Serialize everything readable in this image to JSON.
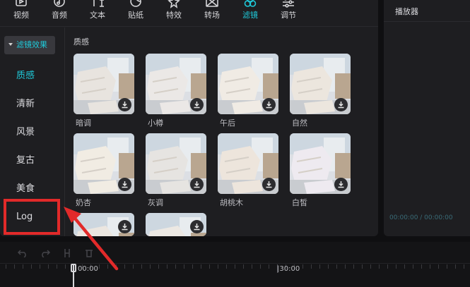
{
  "toolbar": {
    "items": [
      {
        "label": "视频",
        "icon": "video-icon"
      },
      {
        "label": "音频",
        "icon": "audio-icon"
      },
      {
        "label": "文本",
        "icon": "text-icon"
      },
      {
        "label": "贴纸",
        "icon": "sticker-icon"
      },
      {
        "label": "特效",
        "icon": "effects-icon"
      },
      {
        "label": "转场",
        "icon": "transition-icon"
      },
      {
        "label": "滤镜",
        "icon": "filter-icon",
        "active": true
      },
      {
        "label": "调节",
        "icon": "adjust-icon"
      }
    ]
  },
  "sidebar": {
    "header": "滤镜效果",
    "items": [
      {
        "label": "质感",
        "active": true
      },
      {
        "label": "清新"
      },
      {
        "label": "风景"
      },
      {
        "label": "复古"
      },
      {
        "label": "美食",
        "highlighted": true
      },
      {
        "label": "Log"
      }
    ]
  },
  "content": {
    "section_title": "质感",
    "filters": [
      {
        "name": "暗调",
        "tint": "#e8e4df"
      },
      {
        "name": "小樽",
        "tint": "#ebe8e6"
      },
      {
        "name": "午后",
        "tint": "#f0ebe4"
      },
      {
        "name": "自然",
        "tint": "#ece6de"
      },
      {
        "name": "奶杏",
        "tint": "#f1ece3"
      },
      {
        "name": "灰调",
        "tint": "#e6e4e1"
      },
      {
        "name": "胡桃木",
        "tint": "#ede5dc"
      },
      {
        "name": "白皙",
        "tint": "#eeeaf0"
      },
      {
        "name": "",
        "tint": "#ebe6e0"
      },
      {
        "name": "",
        "tint": "#ece8e3"
      }
    ]
  },
  "player": {
    "title": "播放器",
    "timecode": "00:00:00 / 00:00:00"
  },
  "timeline": {
    "start_label": "00:00",
    "mark_label": "|30:00"
  },
  "colors": {
    "accent": "#1fc9d9",
    "highlight": "#e22a2a",
    "panel": "#1e1e21"
  }
}
